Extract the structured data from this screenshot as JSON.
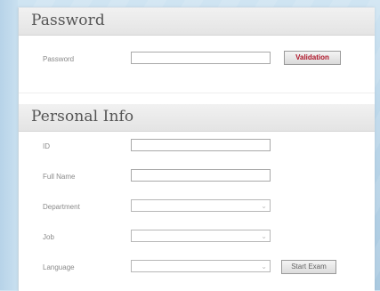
{
  "password_section": {
    "title": "Password",
    "password_label": "Password",
    "password_value": "",
    "validation_button": "Validation"
  },
  "personal_section": {
    "title": "Personal Info",
    "fields": {
      "id_label": "ID",
      "id_value": "",
      "full_name_label": "Full Name",
      "full_name_value": "",
      "department_label": "Department",
      "department_value": "",
      "job_label": "Job",
      "job_value": "",
      "language_label": "Language",
      "language_value": ""
    },
    "start_button": "Start Exam"
  },
  "icons": {
    "select_arrow": "chevron-down-icon"
  }
}
